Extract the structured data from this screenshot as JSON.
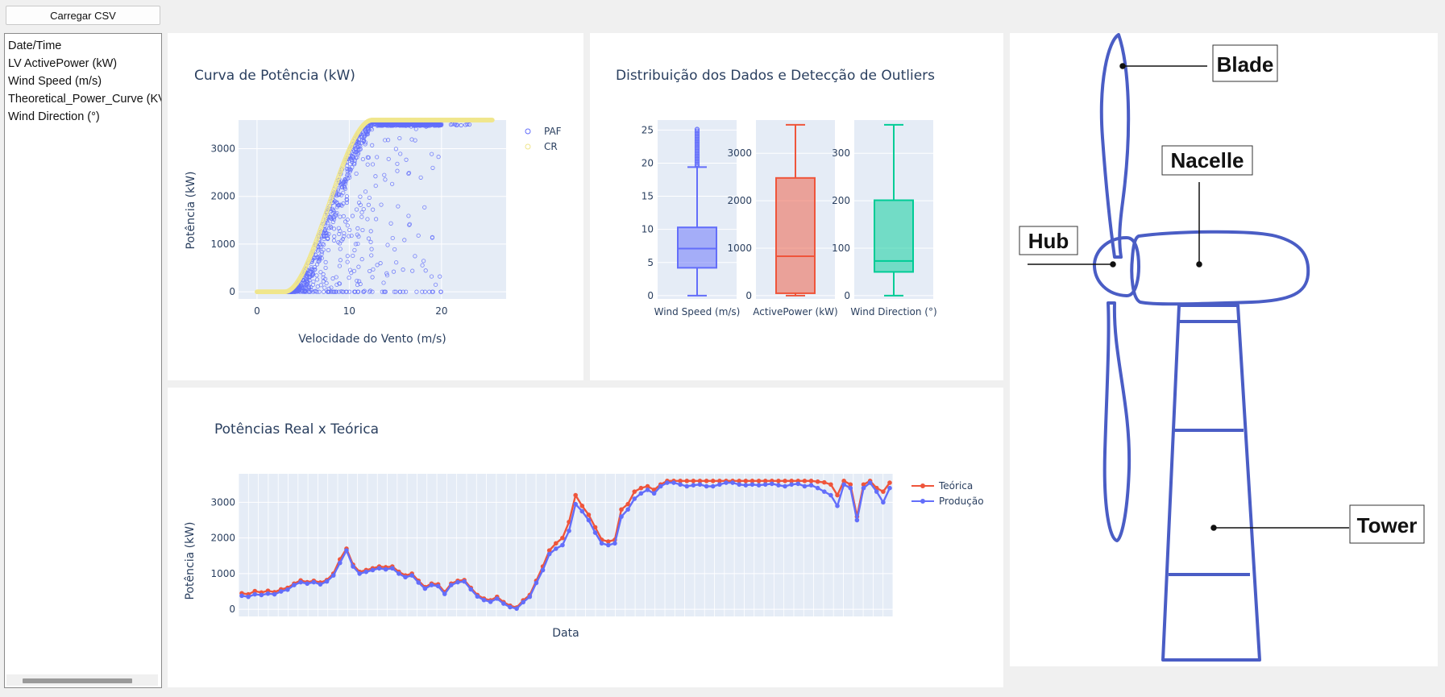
{
  "load_button": {
    "label": "Carregar CSV"
  },
  "column_list": {
    "items": [
      "Date/Time",
      "LV ActivePower (kW)",
      "Wind Speed (m/s)",
      "Theoretical_Power_Curve (KV",
      "Wind Direction (°)"
    ]
  },
  "colors": {
    "plot_bg": "#e5ecf6",
    "series_purple": "#636efa",
    "series_yellow": "#f0e68c",
    "series_red": "#ef553b",
    "series_green": "#00cc96",
    "turbine_blue": "#4a5dc5"
  },
  "power_curve": {
    "title": "Curva de Potência (kW)",
    "xlabel": "Velocidade do Vento (m/s)",
    "ylabel": "Potência (kW)",
    "legend": [
      "PAF",
      "CR"
    ],
    "chart_data": {
      "type": "scatter",
      "xlim": [
        -2,
        27
      ],
      "ylim": [
        -150,
        3600
      ],
      "xticks": [
        0,
        10,
        20
      ],
      "yticks": [
        0,
        1000,
        2000,
        3000
      ],
      "series": [
        {
          "name": "PAF",
          "description_points": [
            [
              0,
              0
            ],
            [
              3,
              0
            ],
            [
              5,
              300
            ],
            [
              7,
              1200
            ],
            [
              9,
              2500
            ],
            [
              11,
              3450
            ],
            [
              13,
              3500
            ],
            [
              15,
              3500
            ],
            [
              20,
              3500
            ],
            [
              23,
              3500
            ]
          ]
        },
        {
          "name": "CR",
          "x": [
            0,
            3,
            4,
            5,
            6,
            7,
            8,
            9,
            10,
            11,
            12,
            13,
            14,
            16,
            18,
            20,
            22,
            24,
            25.5
          ],
          "y": [
            0,
            0,
            90,
            360,
            780,
            1300,
            1950,
            2600,
            3200,
            3530,
            3600,
            3600,
            3600,
            3600,
            3600,
            3600,
            3600,
            3600,
            3600
          ]
        }
      ]
    }
  },
  "distribution": {
    "title": "Distribuição dos Dados e Detecção de Outliers",
    "chart_data": [
      {
        "type": "box",
        "label": "Wind Speed (m/s)",
        "yticks": [
          0,
          5,
          10,
          15,
          20,
          25
        ],
        "ylim": [
          -0.5,
          26.5
        ],
        "min": 0,
        "q1": 4.2,
        "median": 7.1,
        "q3": 10.3,
        "max": 19.4,
        "outliers_to": 25.2
      },
      {
        "type": "box",
        "label": "ActivePower (kW)",
        "yticks": [
          0,
          1000,
          2000,
          3000
        ],
        "ylim": [
          -70,
          3700
        ],
        "min": 0,
        "q1": 50,
        "median": 830,
        "q3": 2480,
        "max": 3600
      },
      {
        "type": "box",
        "label": "Wind Direction (°)",
        "yticks": [
          0,
          100,
          200,
          300
        ],
        "ylim": [
          -7,
          370
        ],
        "min": 0,
        "q1": 50,
        "median": 73,
        "q3": 201,
        "max": 360
      }
    ]
  },
  "real_vs_theoretical": {
    "title": "Potências Real x Teórica",
    "xlabel": "Data",
    "ylabel": "Potência (kW)",
    "chart_data": {
      "type": "line",
      "ylim": [
        -200,
        3800
      ],
      "yticks": [
        0,
        1000,
        2000,
        3000
      ],
      "series": [
        {
          "name": "Teórica",
          "values": [
            450,
            420,
            510,
            470,
            520,
            480,
            560,
            600,
            720,
            810,
            760,
            800,
            750,
            820,
            1000,
            1400,
            1700,
            1250,
            1050,
            1100,
            1150,
            1200,
            1180,
            1200,
            1050,
            950,
            1000,
            800,
            620,
            720,
            700,
            480,
            720,
            800,
            820,
            600,
            400,
            300,
            250,
            350,
            200,
            100,
            50,
            250,
            400,
            800,
            1200,
            1650,
            1850,
            2000,
            2450,
            3200,
            2900,
            2650,
            2300,
            1950,
            1900,
            1950,
            2800,
            2950,
            3300,
            3400,
            3450,
            3350,
            3500,
            3600,
            3600,
            3600,
            3600,
            3600,
            3600,
            3600,
            3600,
            3600,
            3600,
            3600,
            3600,
            3600,
            3600,
            3600,
            3600,
            3600,
            3600,
            3600,
            3600,
            3600,
            3600,
            3600,
            3580,
            3560,
            3500,
            3200,
            3600,
            3500,
            2600,
            3500,
            3600,
            3400,
            3300,
            3550
          ]
        },
        {
          "name": "Produção",
          "values": [
            380,
            350,
            420,
            400,
            440,
            420,
            500,
            550,
            680,
            760,
            720,
            760,
            700,
            780,
            950,
            1300,
            1650,
            1200,
            1000,
            1050,
            1100,
            1150,
            1120,
            1150,
            1000,
            900,
            950,
            750,
            580,
            680,
            650,
            430,
            680,
            760,
            780,
            560,
            360,
            260,
            210,
            300,
            160,
            60,
            20,
            200,
            350,
            740,
            1100,
            1550,
            1700,
            1800,
            2200,
            2950,
            2750,
            2500,
            2150,
            1850,
            1800,
            1850,
            2600,
            2800,
            3100,
            3250,
            3350,
            3250,
            3450,
            3550,
            3550,
            3500,
            3450,
            3480,
            3500,
            3450,
            3450,
            3500,
            3550,
            3550,
            3500,
            3480,
            3500,
            3480,
            3500,
            3520,
            3480,
            3450,
            3500,
            3520,
            3450,
            3480,
            3400,
            3300,
            3200,
            2900,
            3500,
            3400,
            2500,
            3400,
            3550,
            3300,
            3000,
            3400
          ]
        }
      ]
    }
  },
  "turbine": {
    "labels": {
      "blade": "Blade",
      "nacelle": "Nacelle",
      "hub": "Hub",
      "tower": "Tower"
    }
  }
}
